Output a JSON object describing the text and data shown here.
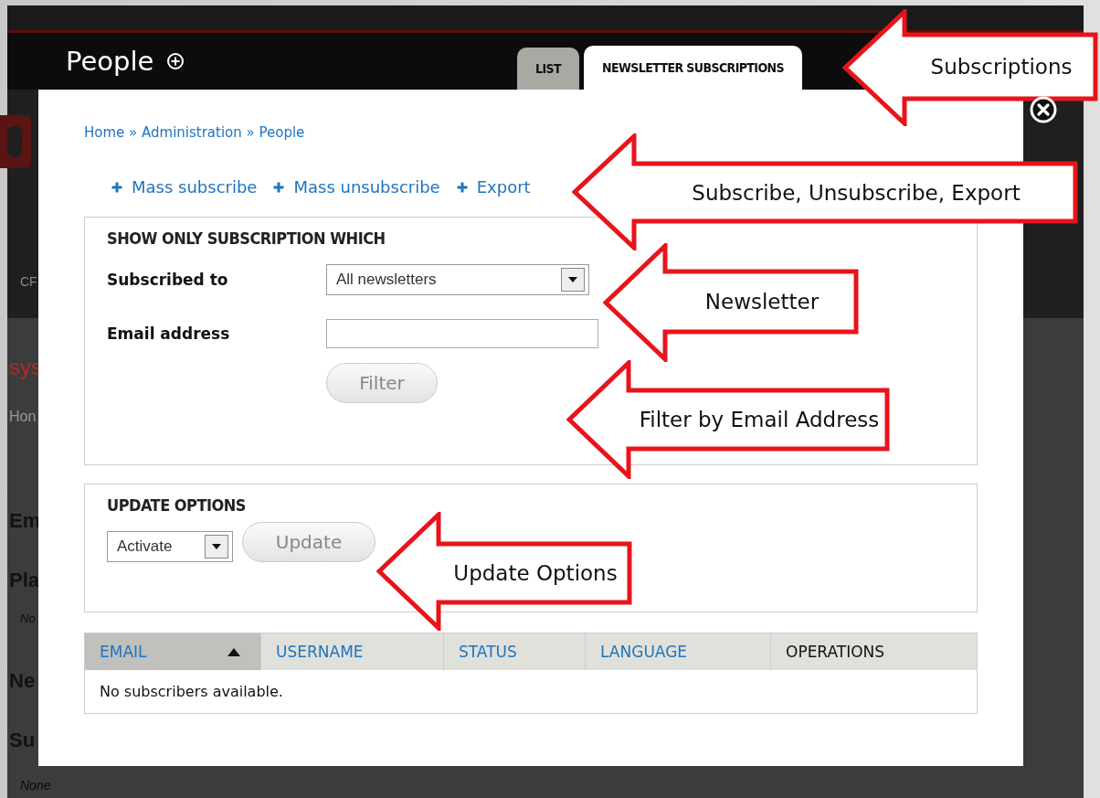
{
  "page": {
    "title": "People",
    "tabs": [
      {
        "label": "LIST",
        "selected": false
      },
      {
        "label": "NEWSLETTER SUBSCRIPTIONS",
        "selected": true
      }
    ],
    "background_fragments": [
      {
        "text": "CF",
        "kind": "menu"
      },
      {
        "text": "sys",
        "kind": "title"
      },
      {
        "text": "Hon",
        "kind": "crumb"
      },
      {
        "text": "Em",
        "kind": "heading"
      },
      {
        "text": "Pla",
        "kind": "heading"
      },
      {
        "text": "No",
        "kind": "note"
      },
      {
        "text": "Ne",
        "kind": "heading"
      },
      {
        "text": "Su",
        "kind": "heading"
      }
    ],
    "footer_note": "None"
  },
  "overlay": {
    "breadcrumb": "Home » Administration » People",
    "actions": [
      "Mass subscribe",
      "Mass unsubscribe",
      "Export"
    ],
    "filter": {
      "legend": "SHOW ONLY SUBSCRIPTION WHICH",
      "fields": [
        {
          "label": "Subscribed to",
          "kind": "select",
          "value": "All newsletters"
        },
        {
          "label": "Email address",
          "kind": "text"
        }
      ],
      "button": "Filter"
    },
    "update": {
      "legend": "UPDATE OPTIONS",
      "select": "Activate",
      "button": "Update"
    },
    "table": {
      "columns": [
        {
          "label": "EMAIL",
          "link": true,
          "sorted": true
        },
        {
          "label": "USERNAME",
          "link": true,
          "sorted": false
        },
        {
          "label": "STATUS",
          "link": true,
          "sorted": false
        },
        {
          "label": "LANGUAGE",
          "link": true,
          "sorted": false
        },
        {
          "label": "OPERATIONS",
          "link": false,
          "sorted": false
        }
      ],
      "empty": "No subscribers available."
    }
  },
  "callouts": [
    {
      "text": "Subscriptions"
    },
    {
      "text": "Subscribe, Unsubscribe, Export"
    },
    {
      "text": "Newsletter"
    },
    {
      "text": "Filter by Email Address"
    },
    {
      "text": "Update Options"
    }
  ]
}
